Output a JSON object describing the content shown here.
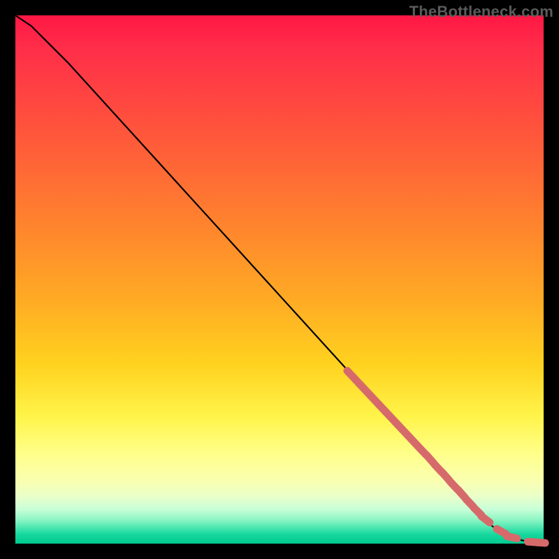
{
  "watermark": "TheBottleneck.com",
  "colors": {
    "curve": "#000000",
    "marker_fill": "#d66a6a",
    "marker_stroke": "#c95a5a"
  },
  "chart_data": {
    "type": "line",
    "title": "",
    "xlabel": "",
    "ylabel": "",
    "xlim": [
      0,
      100
    ],
    "ylim": [
      0,
      100
    ],
    "grid": false,
    "legend": false,
    "note": "Axes carry no tick labels; values are inferred from pixel positions on a 0–100 scale per axis.",
    "series": [
      {
        "name": "curve",
        "kind": "line",
        "x": [
          0,
          3,
          6,
          10,
          15,
          20,
          25,
          30,
          35,
          40,
          45,
          50,
          55,
          60,
          65,
          70,
          75,
          80,
          85,
          88,
          90,
          92,
          94,
          96,
          98,
          100
        ],
        "y": [
          100,
          98,
          95,
          91,
          85.5,
          80,
          74.5,
          69,
          63.5,
          58,
          52.5,
          47,
          41.5,
          36,
          30.5,
          25,
          19.5,
          14,
          8.5,
          5.3,
          3.5,
          2.2,
          1.2,
          0.6,
          0.3,
          0.2
        ]
      },
      {
        "name": "highlight-markers",
        "kind": "scatter",
        "x": [
          63.5,
          65.0,
          66.5,
          68.0,
          69.5,
          71.0,
          72.5,
          74.0,
          75.5,
          77.0,
          78.5,
          80.0,
          81.5,
          83.0,
          84.5,
          86.0,
          87.5,
          89.0,
          92.0,
          94.0,
          98.0,
          99.3
        ],
        "y": [
          32.0,
          30.4,
          28.8,
          27.2,
          25.6,
          24.0,
          22.4,
          20.8,
          19.2,
          17.6,
          16.0,
          14.3,
          12.7,
          11.0,
          9.4,
          7.7,
          6.1,
          4.6,
          2.3,
          1.2,
          0.3,
          0.2
        ]
      }
    ]
  }
}
